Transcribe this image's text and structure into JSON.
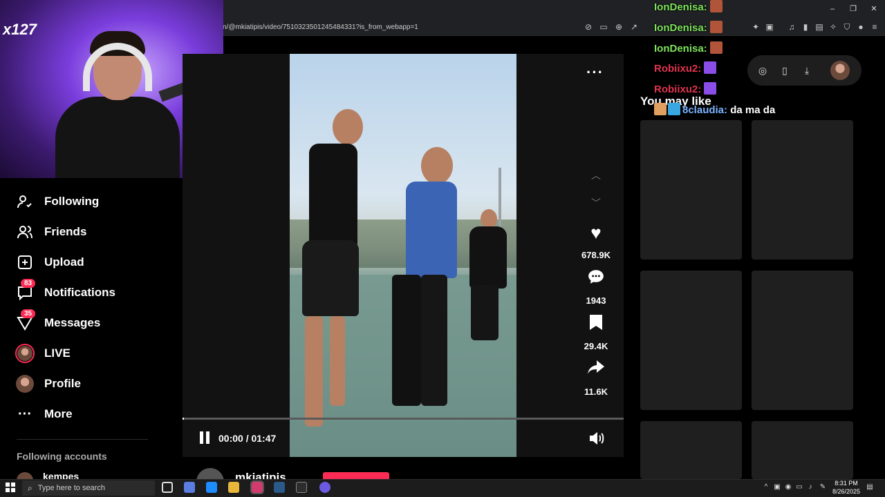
{
  "browser": {
    "url": "n/@mkiatipis/video/7510323501245484331?is_from_webapp=1",
    "window_controls": [
      "–",
      "❐",
      "✕"
    ]
  },
  "sidebar": {
    "items": [
      {
        "label": "Following",
        "icon": "following-icon"
      },
      {
        "label": "Friends",
        "icon": "friends-icon"
      },
      {
        "label": "Upload",
        "icon": "upload-icon"
      },
      {
        "label": "Notifications",
        "icon": "notifications-icon",
        "badge": "83"
      },
      {
        "label": "Messages",
        "icon": "messages-icon",
        "badge": "35"
      },
      {
        "label": "LIVE",
        "icon": "live-avatar"
      },
      {
        "label": "Profile",
        "icon": "profile-avatar"
      },
      {
        "label": "More",
        "icon": "more-icon"
      }
    ],
    "following_accounts_heading": "Following accounts",
    "following_accounts": [
      "kempes"
    ]
  },
  "webcam": {
    "logo": "x127"
  },
  "video": {
    "time": "00:00 / 01:47",
    "progress": 0.0,
    "likes": "678.9K",
    "comments": "1943",
    "saves": "29.4K",
    "shares": "11.6K",
    "author": "mkiatipis"
  },
  "right_pane": {
    "section_title": "You may like"
  },
  "chat": [
    {
      "user": "IonDenisa:",
      "message": "",
      "color": "#7ee35b"
    },
    {
      "user": "IonDenisa:",
      "message": "",
      "color": "#7ee35b"
    },
    {
      "user": "IonDenisa:",
      "message": "",
      "color": "#7ee35b"
    },
    {
      "user": "Robiixu2:",
      "message": "",
      "color": "#e0344e"
    },
    {
      "user": "Robiixu2:",
      "message": "",
      "color": "#e0344e"
    },
    {
      "user": "8claudia:",
      "message": "da ma da",
      "color": "#7ab3ff"
    }
  ],
  "taskbar": {
    "search_placeholder": "Type here to search",
    "time": "8:31 PM",
    "date": "8/26/2025"
  },
  "colors": {
    "accent": "#fe2c55",
    "background": "#000000"
  }
}
